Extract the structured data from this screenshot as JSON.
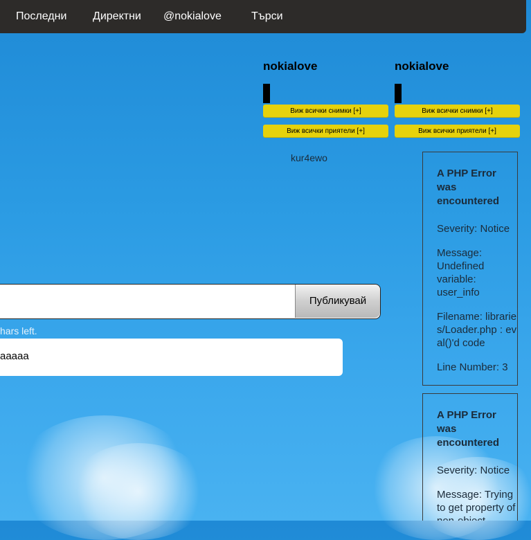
{
  "nav": {
    "items": [
      "Последни",
      "Директни",
      "@nokialove",
      "Търси"
    ]
  },
  "profiles": [
    {
      "username": "nokialove",
      "photos_label": "Виж всички снимки [+]",
      "friends_label": "Виж всички приятели [+]"
    },
    {
      "username": "nokialove",
      "photos_label": "Виж всички снимки [+]",
      "friends_label": "Виж всички приятели [+]"
    }
  ],
  "friend": {
    "name": "kur4ewo"
  },
  "composer": {
    "value": "",
    "publish_label": "Публикувай",
    "chars_left": "hars left."
  },
  "post": {
    "text": "aaaaa"
  },
  "errors": [
    {
      "title": "A PHP Error was encountered",
      "severity": "Severity: Notice",
      "message": "Message: Undefined variable: user_info",
      "filename": "Filename: libraries/Loader.php : eval()'d code",
      "line": "Line Number: 3"
    },
    {
      "title": "A PHP Error was encountered",
      "severity": "Severity: Notice",
      "message": "Message: Trying to get property of non-object"
    }
  ],
  "colors": {
    "topbar": "#2d2b29",
    "accent_button": "#e6d20c",
    "background": "#2b9be3"
  }
}
